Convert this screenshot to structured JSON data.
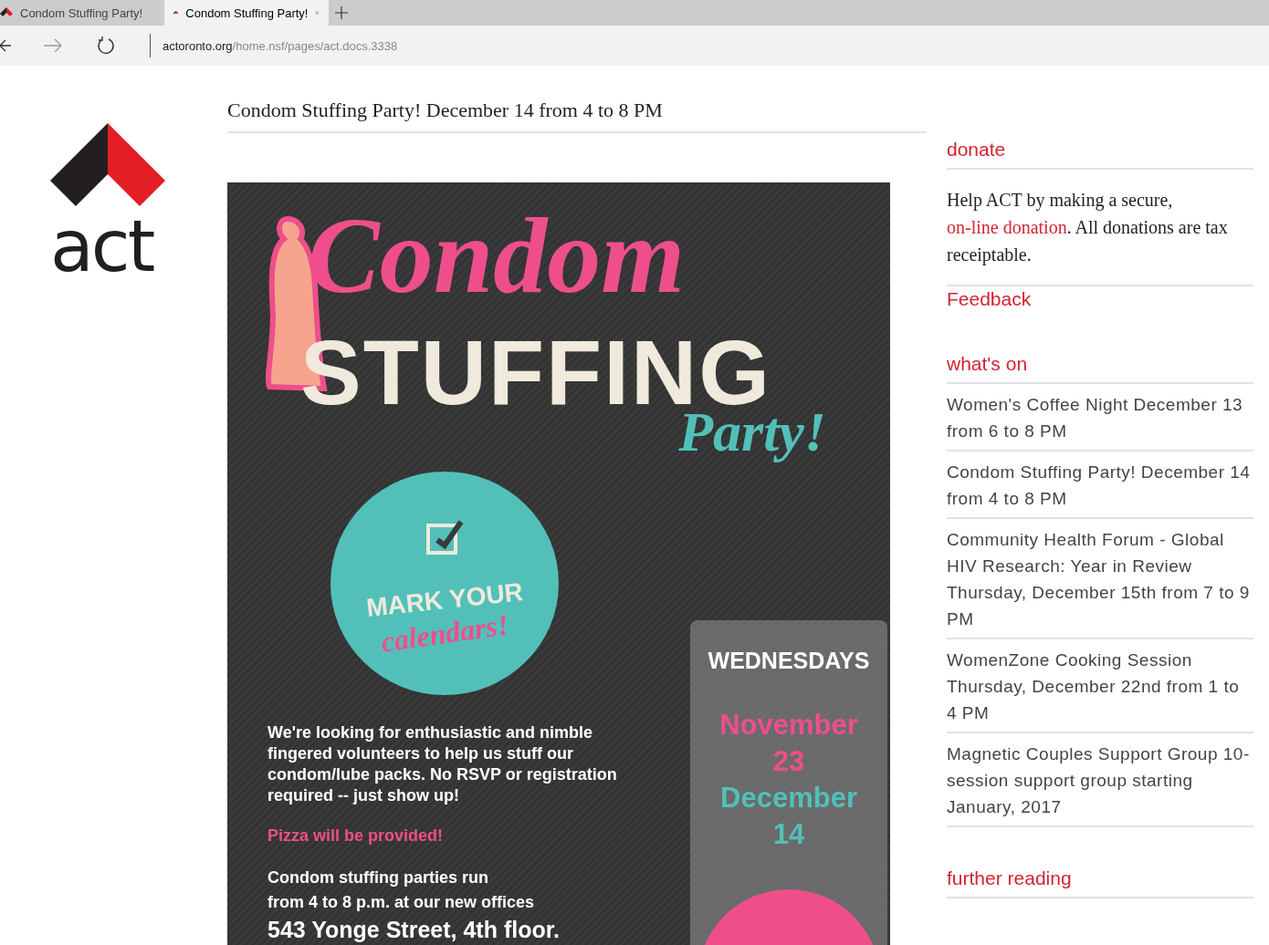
{
  "browser": {
    "tabs": [
      {
        "title": "Condom Stuffing Party!",
        "selected": false
      },
      {
        "title": "Condom Stuffing Party!",
        "selected": true
      }
    ],
    "url": {
      "host": "actoronto.org",
      "path": "/home.nsf/pages/act.docs.3338"
    }
  },
  "logo": {
    "text": "act"
  },
  "article": {
    "title": "Condom Stuffing Party! December 14 from 4 to 8 PM",
    "poster": {
      "title_top": "Condom",
      "title_main": "STUFFING",
      "title_script": "Party!",
      "badge": {
        "line_1": "MARK YOUR",
        "line_2": "calendars!"
      },
      "paragraph": "We're looking for enthusiastic and nimble fingered volunteers to help us stuff our condom/lube packs. No RSVP or registration required -- just show up!",
      "pizza": "Pizza will be provided!",
      "run_lines": [
        "Condom stuffing parties run",
        "from 4 to 8 p.m. at our new offices"
      ],
      "address": "543 Yonge Street, 4th floor.",
      "schedule": {
        "heading": "WEDNESDAYS",
        "dates": [
          {
            "month": "November",
            "day": "23",
            "color": "#ee4f8b"
          },
          {
            "month": "December",
            "day": "14",
            "color": "#52c0b9"
          }
        ]
      }
    }
  },
  "sidebar": {
    "donate": {
      "heading": "donate",
      "text_before": "Help ACT by making a secure, ",
      "link": "on-line donation",
      "text_after": ". All donations are tax receiptable."
    },
    "feedback": "Feedback",
    "whats_on": {
      "heading": "what's on",
      "events": [
        "Women's Coffee Night December 13 from 6 to 8 PM",
        "Condom Stuffing Party! December 14 from 4 to 8 PM",
        "Community Health Forum - Global HIV Research: Year in Review Thursday, December 15th from 7 to 9 PM",
        "WomenZone Cooking Session Thursday, December 22nd from 1 to 4 PM",
        "Magnetic Couples Support Group 10-session support group starting January, 2017"
      ]
    },
    "further_reading": "further reading"
  }
}
